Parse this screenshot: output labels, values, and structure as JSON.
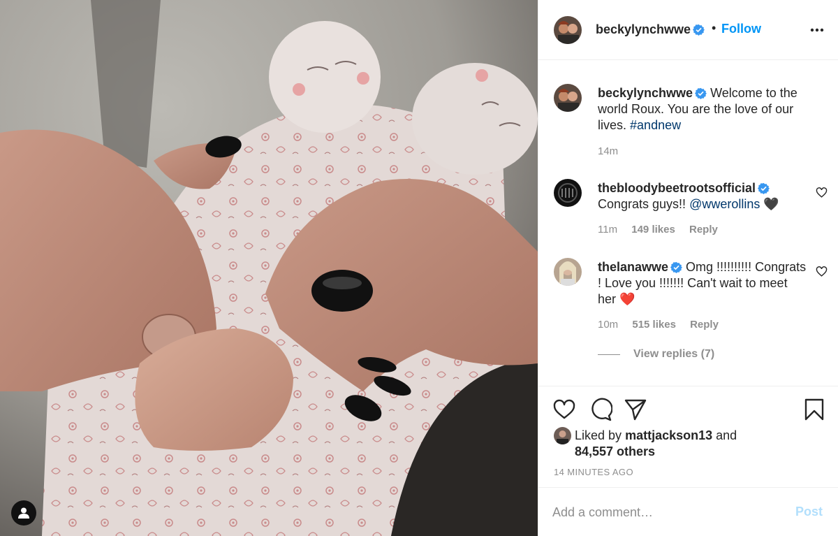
{
  "post": {
    "author": "beckylynchwwe",
    "follow_label": "Follow",
    "separator": "•",
    "caption": {
      "text": "Welcome to the world Roux. You are the love of our lives.",
      "hashtag": "#andnew",
      "time": "14m"
    },
    "likes": {
      "prefix": "Liked by",
      "user": "mattjackson13",
      "conjunction": "and",
      "others": "84,557 others"
    },
    "timestamp": "14 MINUTES AGO"
  },
  "comments": [
    {
      "username": "thebloodybeetrootsofficial",
      "verified": true,
      "text": "Congrats guys!!",
      "mention": "@wwerollins",
      "emoji": "🖤",
      "time": "11m",
      "likes": "149 likes",
      "reply_label": "Reply"
    },
    {
      "username": "thelanawwe",
      "verified": true,
      "text": "Omg !!!!!!!!!! Congrats ! Love you !!!!!!! Can't wait to meet her",
      "emoji": "❤️",
      "time": "10m",
      "likes": "515 likes",
      "reply_label": "Reply",
      "view_replies": "View replies (7)"
    }
  ],
  "comment_box": {
    "placeholder": "Add a comment…",
    "post_label": "Post"
  },
  "icons": {
    "more": "more-horizontal-icon",
    "like": "heart-icon",
    "comment": "comment-bubble-icon",
    "share": "paper-plane-icon",
    "save": "bookmark-icon",
    "verified": "verified-badge-icon",
    "user_tag": "user-tag-icon"
  },
  "colors": {
    "link_blue": "#0095f6",
    "verified_blue": "#3897f0",
    "hashtag": "#00376b",
    "muted": "#8e8e8e",
    "post_disabled": "#b2dffc",
    "heart_red": "#ed4956"
  }
}
